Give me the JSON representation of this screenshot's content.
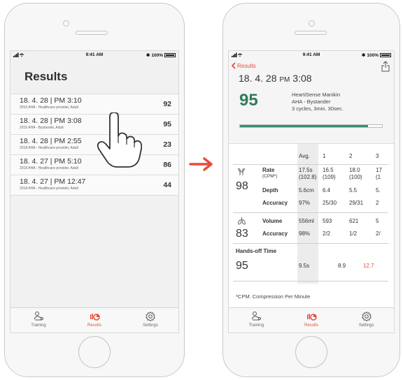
{
  "status": {
    "time": "9:41 AM",
    "battery": "100%"
  },
  "results_screen": {
    "title": "Results",
    "rows": [
      {
        "datetime": "18. 4. 28  |  PM 3:10",
        "desc": "2015 AHA - Healthcare provider, Adult",
        "score": "92"
      },
      {
        "datetime": "18. 4. 28  |  PM 3:08",
        "desc": "2015 AHA - Bystander, Adult",
        "score": "95"
      },
      {
        "datetime": "18. 4. 28  |  PM 2:55",
        "desc": "2018 AHA - Healthcare provider, Adult",
        "score": "23"
      },
      {
        "datetime": "18. 4. 27  |  PM 5:10",
        "desc": "2018 AHA - Healthcare provider, Adult",
        "score": "86"
      },
      {
        "datetime": "18. 4. 27  |  PM 12:47",
        "desc": "2018 AHA - Healthcare provider, Adult",
        "score": "44"
      }
    ]
  },
  "tabs": {
    "training": "Training",
    "results": "Results",
    "settings": "Settings"
  },
  "detail_screen": {
    "back_label": "Results",
    "date": "18. 4. 28",
    "date_pm": "PM",
    "date_time": "3:08",
    "score": "95",
    "device_line1": "HeartiSense Manikin",
    "device_line2": "AHA - Bystander",
    "device_line3": "3 cycles, 3min. 30sec.",
    "progress_fraction": 0.9,
    "table_headers": [
      "Avg.",
      "1",
      "2",
      "3"
    ],
    "compression": {
      "score": "98",
      "rate_label": "Rate",
      "rate_sub": "(CPM*)",
      "rate_avg": "17.5s",
      "rate_avg_sub": "(102.8)",
      "rate_1": "16.5",
      "rate_1_sub": "(109)",
      "rate_2": "18.0",
      "rate_2_sub": "(100)",
      "rate_3": "17",
      "rate_3_sub": "(1",
      "depth_label": "Depth",
      "depth_avg": "5.6cm",
      "depth_1": "6.4",
      "depth_2": "5.5",
      "depth_3": "5.",
      "accuracy_label": "Accuracy",
      "acc_avg": "97%",
      "acc_1": "25/30",
      "acc_2": "29/31",
      "acc_3": "2"
    },
    "breathing": {
      "score": "83",
      "volume_label": "Volume",
      "vol_avg": "556ml",
      "vol_1": "593",
      "vol_2": "621",
      "vol_3": "5",
      "accuracy_label": "Accuracy",
      "acc_avg": "98%",
      "acc_1": "2/2",
      "acc_2": "1/2",
      "acc_3": "2/"
    },
    "hands_off": {
      "label": "Hands-off Time",
      "score": "95",
      "avg": "9.5s",
      "v1": "8.9",
      "v2": "12.7"
    },
    "footnote": "*CPM: Compression Per Minute"
  },
  "colors": {
    "accent": "#e94b3c",
    "score_green": "#2e7d5c",
    "progress": "#3a8f6f"
  }
}
